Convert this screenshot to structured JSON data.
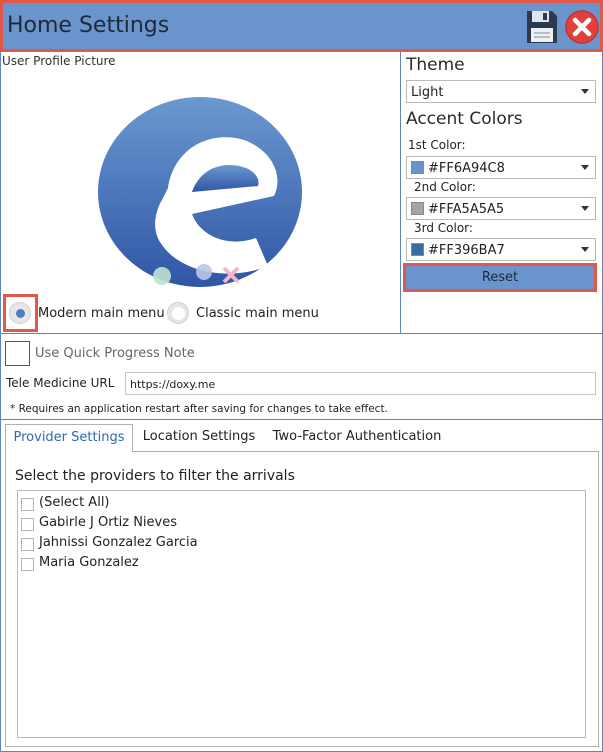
{
  "window": {
    "title": "Home Settings"
  },
  "profile": {
    "label": "User Profile Picture"
  },
  "theme": {
    "heading": "Theme",
    "selected": "Light"
  },
  "accent": {
    "heading": "Accent Colors",
    "colors": [
      {
        "label": "1st Color:",
        "value": "#FF6A94C8",
        "hex": "#6A94C8"
      },
      {
        "label": "2nd Color:",
        "value": "#FFA5A5A5",
        "hex": "#A5A5A5"
      },
      {
        "label": "3rd Color:",
        "value": "#FF396BA7",
        "hex": "#396BA7"
      }
    ],
    "reset_label": "Reset"
  },
  "menu_style": {
    "modern_label": "Modern main menu",
    "modern_selected": true,
    "classic_label": "Classic main menu"
  },
  "quick_progress": {
    "label": "Use Quick Progress Note",
    "checked": false
  },
  "tele_medicine": {
    "label": "Tele Medicine URL",
    "value": "https://doxy.me"
  },
  "restart_note": "* Requires an application restart after saving for changes to take effect.",
  "tabs": [
    {
      "label": "Provider Settings",
      "active": true
    },
    {
      "label": "Location Settings",
      "active": false
    },
    {
      "label": "Two-Factor Authentication",
      "active": false
    }
  ],
  "providers": {
    "heading": "Select the providers to filter the arrivals",
    "items": [
      "(Select All)",
      "Gabirle J Ortiz Nieves",
      "Jahnissi Gonzalez Garcia",
      "Maria Gonzalez"
    ]
  },
  "icons": {
    "save": "floppy-disk-icon",
    "close": "close-circle-icon",
    "logo": "e-logo"
  },
  "colors": {
    "accent": "#6A94CB",
    "highlight": "#E0584A",
    "brand_blue": "#2F5BAA"
  }
}
